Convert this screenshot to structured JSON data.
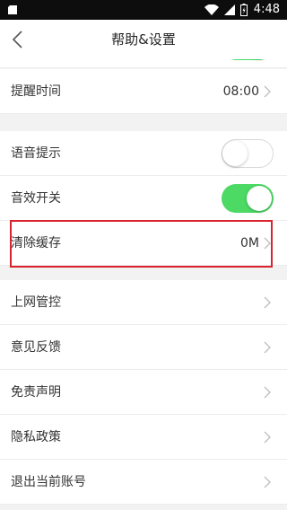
{
  "status_bar": {
    "time": "4:48",
    "icons": [
      "sim-icon",
      "wifi-icon",
      "signal-icon",
      "battery-icon"
    ]
  },
  "header": {
    "title": "帮助&设置",
    "back_icon": "chevron-left-icon"
  },
  "settings": {
    "top_toggle_on": true,
    "reminder": {
      "label": "提醒时间",
      "value": "08:00"
    },
    "voice_prompt": {
      "label": "语音提示",
      "on": false
    },
    "sound_effect": {
      "label": "音效开关",
      "on": true
    },
    "clear_cache": {
      "label": "清除缓存",
      "value": "0M"
    },
    "links": [
      {
        "label": "上网管控"
      },
      {
        "label": "意见反馈"
      },
      {
        "label": "免责声明"
      },
      {
        "label": "隐私政策"
      },
      {
        "label": "退出当前账号"
      }
    ]
  },
  "colors": {
    "toggle_on": "#4cd964",
    "highlight": "#d9232e",
    "section_gap": "#f2f2f2"
  }
}
